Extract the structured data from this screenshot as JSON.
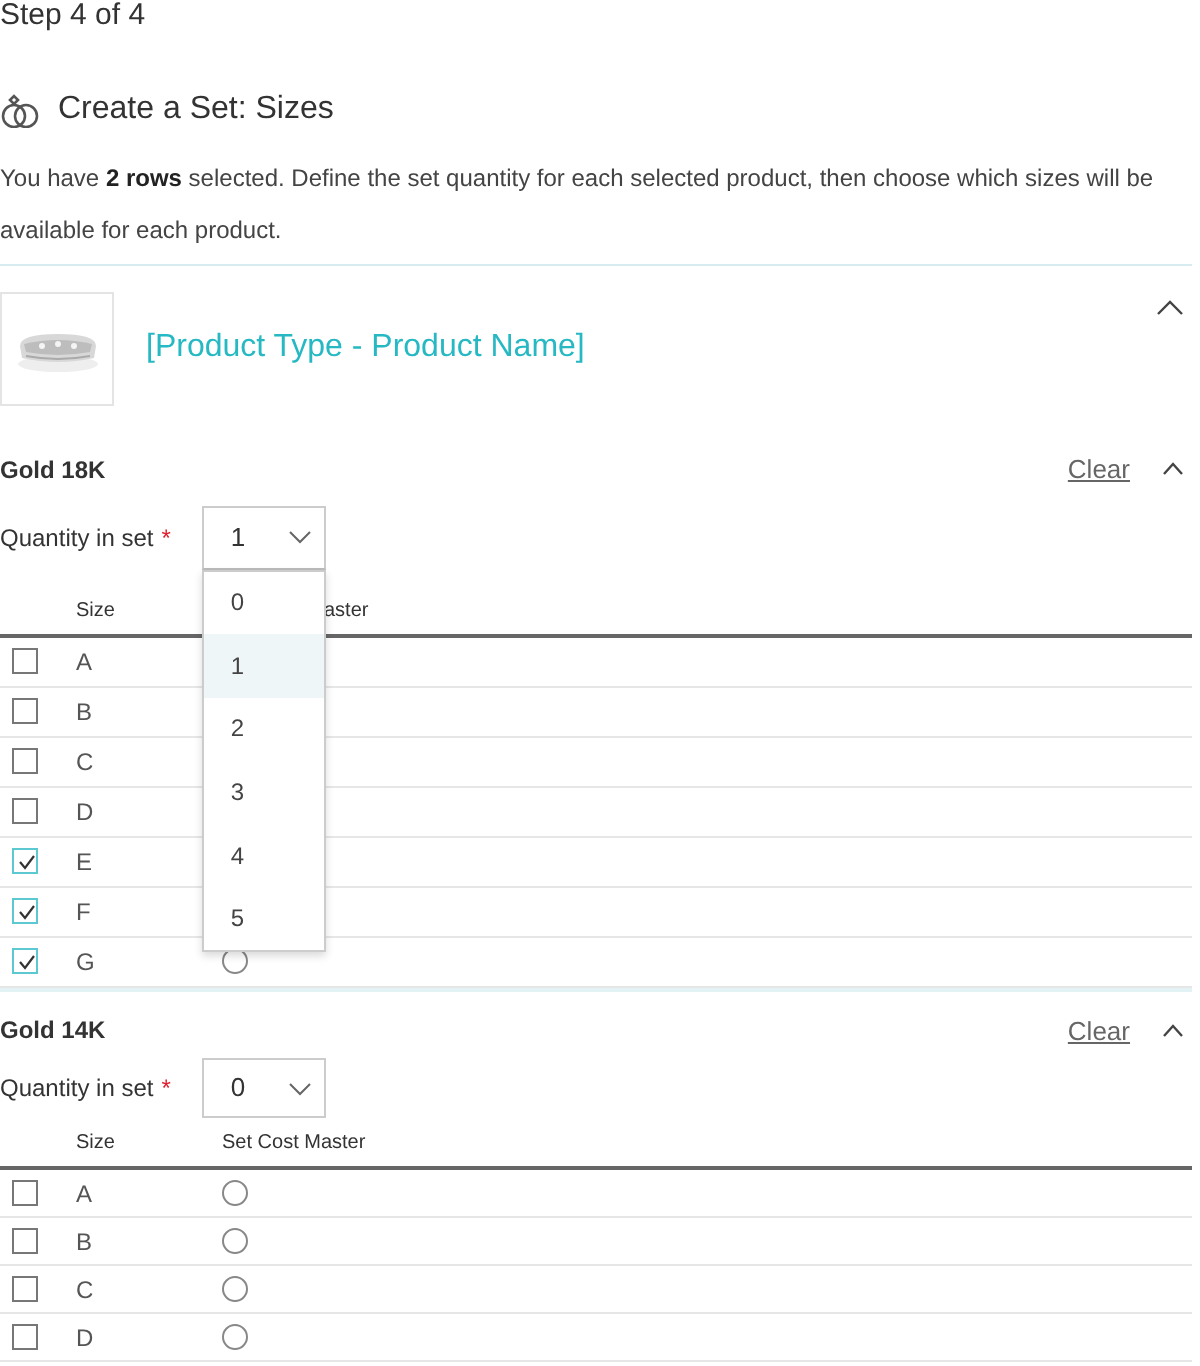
{
  "step": "Step 4 of 4",
  "heading": "Create a Set: Sizes",
  "intro": "You have **2 rows** selected. Define the set quantity for each selected product, then choose which sizes will be available for each product.",
  "product": {
    "name": "[Product Type - Product Name]",
    "expanded": true
  },
  "groups": [
    {
      "title": "Gold 18K",
      "clear": "Clear",
      "expanded": true,
      "quantity_label": "Quantity in set",
      "required": "*",
      "quantity": "1",
      "dropdown": {
        "open": true,
        "options": [
          {
            "label": "0",
            "selected": false
          },
          {
            "label": "1",
            "selected": true
          },
          {
            "label": "2",
            "selected": false
          },
          {
            "label": "3",
            "selected": false
          },
          {
            "label": "4",
            "selected": false
          },
          {
            "label": "5",
            "selected": false
          }
        ]
      },
      "columns": [
        "Size",
        "aster"
      ],
      "rows": [
        {
          "checked": false,
          "size": "A"
        },
        {
          "checked": false,
          "size": "B"
        },
        {
          "checked": false,
          "size": "C"
        },
        {
          "checked": false,
          "size": "D"
        },
        {
          "checked": true,
          "size": "E"
        },
        {
          "checked": true,
          "size": "F"
        },
        {
          "checked": true,
          "size": "G",
          "master": {
            "selected": false
          }
        }
      ]
    },
    {
      "title": "Gold 14K",
      "clear": "Clear",
      "expanded": true,
      "quantity_label": "Quantity in set",
      "required": "*",
      "quantity": "0",
      "dropdown": {
        "open": false
      },
      "columns": [
        "Size",
        "Set Cost Master"
      ],
      "rows": [
        {
          "checked": false,
          "size": "A",
          "master": {
            "selected": false
          }
        },
        {
          "checked": false,
          "size": "B",
          "master": {
            "selected": false
          }
        },
        {
          "checked": false,
          "size": "C",
          "master": {
            "selected": false
          }
        },
        {
          "checked": false,
          "size": "D",
          "master": {
            "selected": false
          }
        }
      ]
    }
  ]
}
